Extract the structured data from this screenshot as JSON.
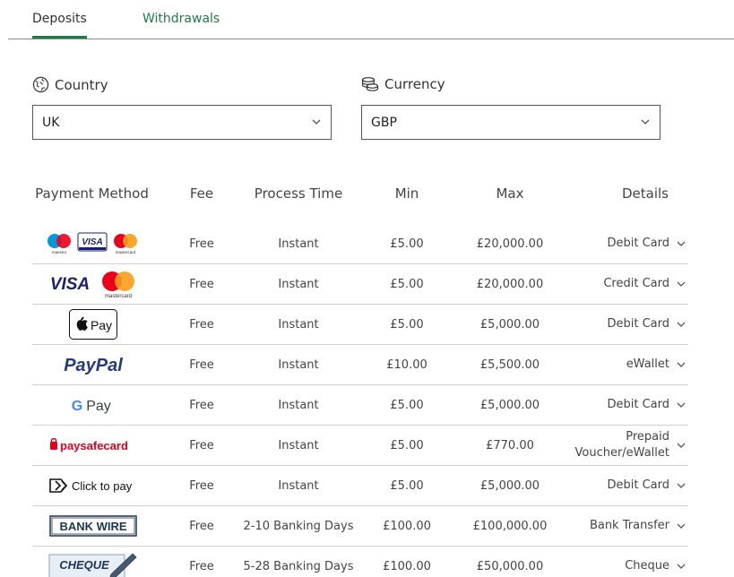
{
  "tabs": {
    "deposits": "Deposits",
    "withdrawals": "Withdrawals"
  },
  "country": {
    "label": "Country",
    "value": "UK"
  },
  "currency": {
    "label": "Currency",
    "value": "GBP"
  },
  "table": {
    "headers": [
      "Payment Method",
      "Fee",
      "Process Time",
      "Min",
      "Max",
      "Details"
    ],
    "rows": [
      {
        "method": "maestro-visa-mastercard",
        "logo_text": [
          "maestro",
          "VISA",
          "mastercard"
        ],
        "fee": "Free",
        "time": "Instant",
        "min": "£5.00",
        "max": "£20,000.00",
        "details": "Debit Card"
      },
      {
        "method": "visa-mastercard",
        "logo_text": [
          "VISA",
          "mastercard"
        ],
        "fee": "Free",
        "time": "Instant",
        "min": "£5.00",
        "max": "£20,000.00",
        "details": "Credit Card"
      },
      {
        "method": "apple-pay",
        "logo_text": [
          "Pay"
        ],
        "fee": "Free",
        "time": "Instant",
        "min": "£5.00",
        "max": "£5,000.00",
        "details": "Debit Card"
      },
      {
        "method": "paypal",
        "logo_text": [
          "PayPal"
        ],
        "fee": "Free",
        "time": "Instant",
        "min": "£10.00",
        "max": "£5,500.00",
        "details": "eWallet"
      },
      {
        "method": "google-pay",
        "logo_text": [
          "G",
          "Pay"
        ],
        "fee": "Free",
        "time": "Instant",
        "min": "£5.00",
        "max": "£5,000.00",
        "details": "Debit Card"
      },
      {
        "method": "paysafecard",
        "logo_text": [
          "paysafecard"
        ],
        "fee": "Free",
        "time": "Instant",
        "min": "£5.00",
        "max": "£770.00",
        "details": "Prepaid Voucher/eWallet"
      },
      {
        "method": "click-to-pay",
        "logo_text": [
          "Click to pay"
        ],
        "fee": "Free",
        "time": "Instant",
        "min": "£5.00",
        "max": "£5,000.00",
        "details": "Debit Card"
      },
      {
        "method": "bank-wire",
        "logo_text": [
          "BANK WIRE"
        ],
        "fee": "Free",
        "time": "2-10 Banking Days",
        "min": "£100.00",
        "max": "£100,000.00",
        "details": "Bank Transfer"
      },
      {
        "method": "cheque",
        "logo_text": [
          "CHEQUE"
        ],
        "fee": "Free",
        "time": "5-28 Banking Days",
        "min": "£100.00",
        "max": "£50,000.00",
        "details": "Cheque"
      }
    ]
  },
  "colors": {
    "accent": "#1f7a4a",
    "paypal_dark": "#253b80",
    "paypal_light": "#179bd7",
    "paysafe_red": "#e2001a",
    "paysafe_blue": "#2e8fd8",
    "visa_blue": "#1a1f71",
    "mc_red": "#eb001b",
    "mc_orange": "#f79e1b",
    "maestro_blue": "#0099df"
  },
  "icons": {
    "country": "globe-icon",
    "currency": "coins-icon",
    "dropdown": "chevron-down-icon",
    "expand": "chevron-down-icon"
  }
}
